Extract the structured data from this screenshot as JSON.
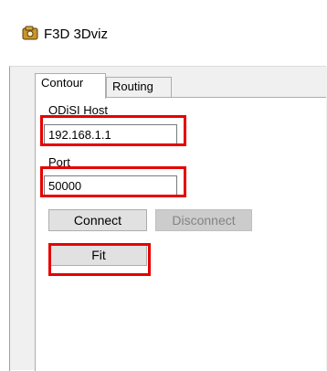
{
  "window": {
    "title": "F3D 3Dviz"
  },
  "tabs": [
    {
      "label": "Contour",
      "active": true
    },
    {
      "label": "Routing",
      "active": false
    }
  ],
  "form": {
    "host_label": "ODiSI Host",
    "host_value": "192.168.1.1",
    "port_label": "Port",
    "port_value": "50000"
  },
  "buttons": {
    "connect": "Connect",
    "disconnect": "Disconnect",
    "fit": "Fit"
  },
  "colors": {
    "highlight": "#e60000",
    "window_bg": "#f0f0f0"
  }
}
